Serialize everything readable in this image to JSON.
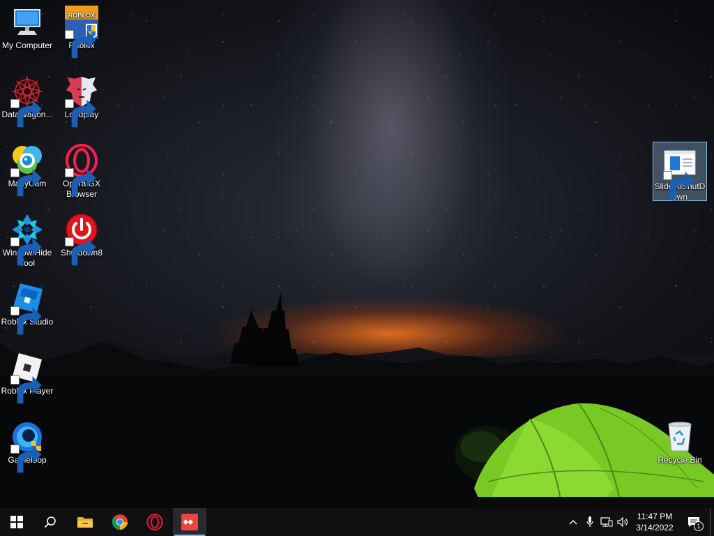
{
  "desktop": {
    "icons": [
      {
        "label": "My Computer"
      },
      {
        "label": "Roblox"
      },
      {
        "label": "DataWagon..."
      },
      {
        "label": "Loudplay"
      },
      {
        "label": "ManyCam"
      },
      {
        "label": "Opera GX Browser"
      },
      {
        "label": "Window Hide Tool"
      },
      {
        "label": "Shutdown8"
      },
      {
        "label": "Roblox Studio"
      },
      {
        "label": "Roblox Player"
      },
      {
        "label": "Gameloop"
      },
      {
        "label": "SlideToShutDown"
      },
      {
        "label": "Recycle Bin"
      }
    ],
    "roblox_logo_text": "ROBLOX"
  },
  "taskbar": {
    "pinned": [
      {
        "icon": "windows-start-icon"
      },
      {
        "icon": "search-icon"
      },
      {
        "icon": "file-explorer-icon"
      },
      {
        "icon": "chrome-icon"
      },
      {
        "icon": "opera-icon"
      },
      {
        "icon": "anydesk-icon"
      }
    ],
    "tray": {
      "icons": [
        "chevron-up-icon",
        "microphone-icon",
        "network-icon",
        "volume-icon"
      ],
      "time": "11:47 PM",
      "date": "3/14/2022",
      "notification_count": "1"
    }
  },
  "colors": {
    "taskbar_bg": "#101012",
    "accent": "#76b9ed",
    "tent_green": "#7ad12a"
  }
}
